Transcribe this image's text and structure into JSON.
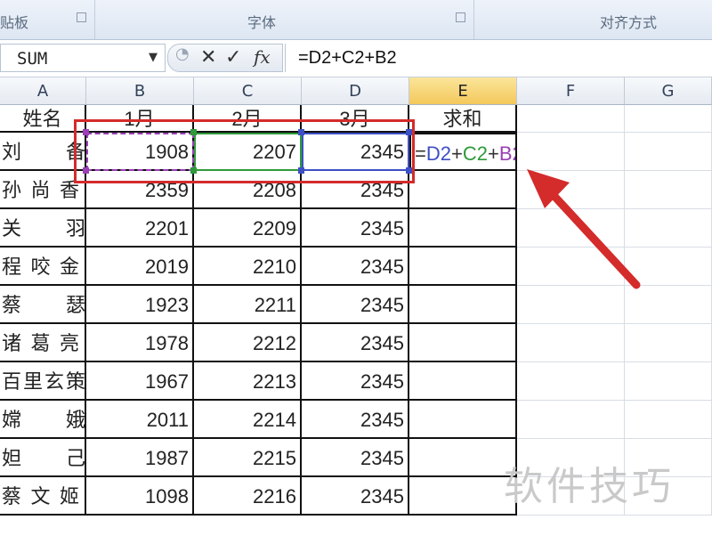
{
  "ribbon": {
    "groups": [
      {
        "label": "贴板"
      },
      {
        "label": "字体"
      },
      {
        "label": "对齐方式"
      }
    ]
  },
  "formula_bar": {
    "name_box": "SUM",
    "cancel_glyph": "✕",
    "enter_glyph": "✓",
    "fx_glyph": "fx",
    "formula": "=D2+C2+B2"
  },
  "columns": [
    "A",
    "B",
    "C",
    "D",
    "E",
    "F",
    "G"
  ],
  "active_column": "E",
  "headers": [
    "姓名",
    "1月",
    "2月",
    "3月",
    "求和"
  ],
  "rows": [
    {
      "name": "刘　　备",
      "b": "1908",
      "c": "2207",
      "d": "2345"
    },
    {
      "name": "孙尚香",
      "b": "2359",
      "c": "2208",
      "d": "2345"
    },
    {
      "name": "关　　羽",
      "b": "2201",
      "c": "2209",
      "d": "2345"
    },
    {
      "name": "程咬金",
      "b": "2019",
      "c": "2210",
      "d": "2345"
    },
    {
      "name": "蔡　　瑟",
      "b": "1923",
      "c": "2211",
      "d": "2345"
    },
    {
      "name": "诸葛亮",
      "b": "1978",
      "c": "2212",
      "d": "2345"
    },
    {
      "name": "百里玄策",
      "b": "1967",
      "c": "2213",
      "d": "2345"
    },
    {
      "name": "嫦　　娥",
      "b": "2011",
      "c": "2214",
      "d": "2345"
    },
    {
      "name": "妲　　己",
      "b": "1987",
      "c": "2215",
      "d": "2345"
    },
    {
      "name": "蔡文姬",
      "b": "1098",
      "c": "2216",
      "d": "2345"
    }
  ],
  "editing_cell": {
    "parts": [
      {
        "text": "=",
        "ref": "op"
      },
      {
        "text": "D2",
        "ref": "d"
      },
      {
        "text": "+",
        "ref": "op"
      },
      {
        "text": "C2",
        "ref": "c"
      },
      {
        "text": "+",
        "ref": "op"
      },
      {
        "text": "B2",
        "ref": "b"
      }
    ]
  },
  "colors": {
    "ref_b": "#9a3fb6",
    "ref_c": "#2e9a3a",
    "ref_d": "#3d4fc4",
    "annotation": "#d42b2b",
    "active_header": "#f4c85c"
  },
  "watermark": "软件技巧"
}
